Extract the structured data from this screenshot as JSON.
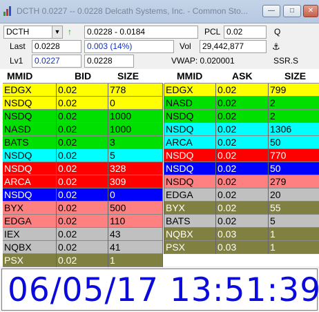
{
  "window": {
    "title": "DCTH  0.0227 -- 0.0228   Delcath Systems, Inc. - Common Sto...",
    "minimize": "—",
    "maximize": "□",
    "close": "✕"
  },
  "quote": {
    "symbol": "DCTH",
    "dropdown_arrow": "▼",
    "trend_arrow": "↑",
    "range": "0.0228 - 0.0184",
    "pcl_label": "PCL",
    "pcl_value": "0.02",
    "q_label": "Q",
    "last_label": "Last",
    "last_value": "0.0228",
    "change": "0.003  (14%)",
    "vol_label": "Vol",
    "vol_value": "29,442,877",
    "anchor_icon": "⚓",
    "lv1_label": "Lv1",
    "lv1_bid": "0.0227",
    "lv1_ask": "0.0228",
    "vwap": "VWAP: 0.020001",
    "ssr": "SSR.S"
  },
  "columns": {
    "bid": [
      "MMID",
      "BID",
      "SIZE"
    ],
    "ask": [
      "MMID",
      "ASK",
      "SIZE"
    ]
  },
  "bids": [
    {
      "mmid": "EDGX",
      "price": "0.02",
      "size": "778",
      "bg": "#ffff00",
      "fg": "#000000"
    },
    {
      "mmid": "NSDQ",
      "price": "0.02",
      "size": "0",
      "bg": "#ffff00",
      "fg": "#000000"
    },
    {
      "mmid": "NSDQ",
      "price": "0.02",
      "size": "1000",
      "bg": "#00e000",
      "fg": "#000000"
    },
    {
      "mmid": "NASD",
      "price": "0.02",
      "size": "1000",
      "bg": "#00e000",
      "fg": "#000000"
    },
    {
      "mmid": "BATS",
      "price": "0.02",
      "size": "3",
      "bg": "#00e000",
      "fg": "#000000"
    },
    {
      "mmid": "NSDQ",
      "price": "0.02",
      "size": "5",
      "bg": "#00ffff",
      "fg": "#000000"
    },
    {
      "mmid": "NSDQ",
      "price": "0.02",
      "size": "328",
      "bg": "#ff0000",
      "fg": "#ffffff"
    },
    {
      "mmid": "ARCA",
      "price": "0.02",
      "size": "309",
      "bg": "#ff0000",
      "fg": "#ffffff"
    },
    {
      "mmid": "NSDQ",
      "price": "0.02",
      "size": "0",
      "bg": "#0000ff",
      "fg": "#ffffff"
    },
    {
      "mmid": "BYX",
      "price": "0.02",
      "size": "500",
      "bg": "#ff8080",
      "fg": "#000000"
    },
    {
      "mmid": "EDGA",
      "price": "0.02",
      "size": "110",
      "bg": "#ff8080",
      "fg": "#000000"
    },
    {
      "mmid": "IEX",
      "price": "0.02",
      "size": "43",
      "bg": "#c0c0c0",
      "fg": "#000000"
    },
    {
      "mmid": "NQBX",
      "price": "0.02",
      "size": "41",
      "bg": "#c0c0c0",
      "fg": "#000000"
    },
    {
      "mmid": "PSX",
      "price": "0.02",
      "size": "1",
      "bg": "#808040",
      "fg": "#ffffff"
    }
  ],
  "asks": [
    {
      "mmid": "EDGX",
      "price": "0.02",
      "size": "799",
      "bg": "#ffff00",
      "fg": "#000000"
    },
    {
      "mmid": "NASD",
      "price": "0.02",
      "size": "2",
      "bg": "#00e000",
      "fg": "#000000"
    },
    {
      "mmid": "NSDQ",
      "price": "0.02",
      "size": "2",
      "bg": "#00e000",
      "fg": "#000000"
    },
    {
      "mmid": "NSDQ",
      "price": "0.02",
      "size": "1306",
      "bg": "#00ffff",
      "fg": "#000000"
    },
    {
      "mmid": "ARCA",
      "price": "0.02",
      "size": "50",
      "bg": "#00ffff",
      "fg": "#000000"
    },
    {
      "mmid": "NSDQ",
      "price": "0.02",
      "size": "770",
      "bg": "#ff0000",
      "fg": "#ffffff"
    },
    {
      "mmid": "NSDQ",
      "price": "0.02",
      "size": "50",
      "bg": "#0000ff",
      "fg": "#ffffff"
    },
    {
      "mmid": "NSDQ",
      "price": "0.02",
      "size": "279",
      "bg": "#ff8080",
      "fg": "#000000"
    },
    {
      "mmid": "EDGA",
      "price": "0.02",
      "size": "20",
      "bg": "#c0c0c0",
      "fg": "#000000"
    },
    {
      "mmid": "BYX",
      "price": "0.02",
      "size": "55",
      "bg": "#808040",
      "fg": "#ffffff"
    },
    {
      "mmid": "BATS",
      "price": "0.02",
      "size": "5",
      "bg": "#c0c0c0",
      "fg": "#000000"
    },
    {
      "mmid": "NQBX",
      "price": "0.03",
      "size": "1",
      "bg": "#808040",
      "fg": "#ffffff"
    },
    {
      "mmid": "PSX",
      "price": "0.03",
      "size": "1",
      "bg": "#808040",
      "fg": "#ffffff"
    }
  ],
  "clock": "06/05/17 13:51:39"
}
